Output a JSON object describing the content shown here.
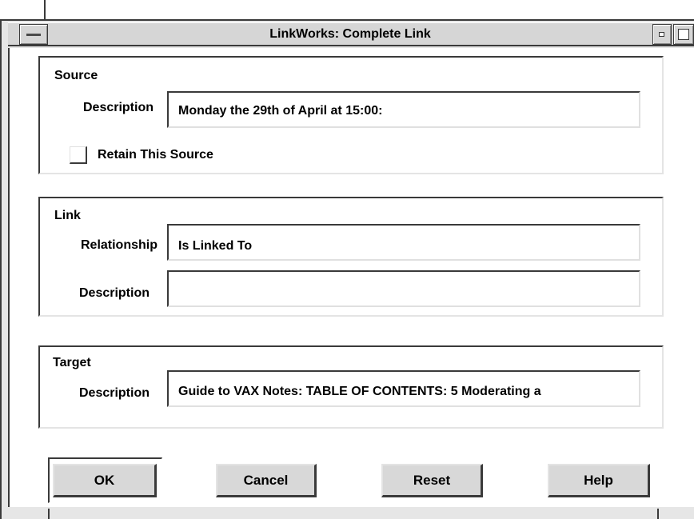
{
  "window": {
    "title": "LinkWorks: Complete Link"
  },
  "source": {
    "group_label": "Source",
    "description_label": "Description",
    "description_value": "Monday the 29th of April at 15:00:",
    "retain_label": "Retain This Source",
    "retain_checked": false
  },
  "link": {
    "group_label": "Link",
    "relationship_label": "Relationship",
    "relationship_value": "Is Linked To",
    "description_label": "Description",
    "description_value": ""
  },
  "target": {
    "group_label": "Target",
    "description_label": "Description",
    "description_value": "Guide to VAX Notes: TABLE OF CONTENTS: 5 Moderating a"
  },
  "buttons": {
    "ok": "OK",
    "cancel": "Cancel",
    "reset": "Reset",
    "help": "Help"
  },
  "icons": {
    "window_menu": "window-menu-icon",
    "minimize": "minimize-icon",
    "maximize": "maximize-icon"
  },
  "colors": {
    "dark_edge": "#3a3a3a",
    "button_face": "#d8d8d8",
    "frame_gray": "#e6e6e6"
  }
}
